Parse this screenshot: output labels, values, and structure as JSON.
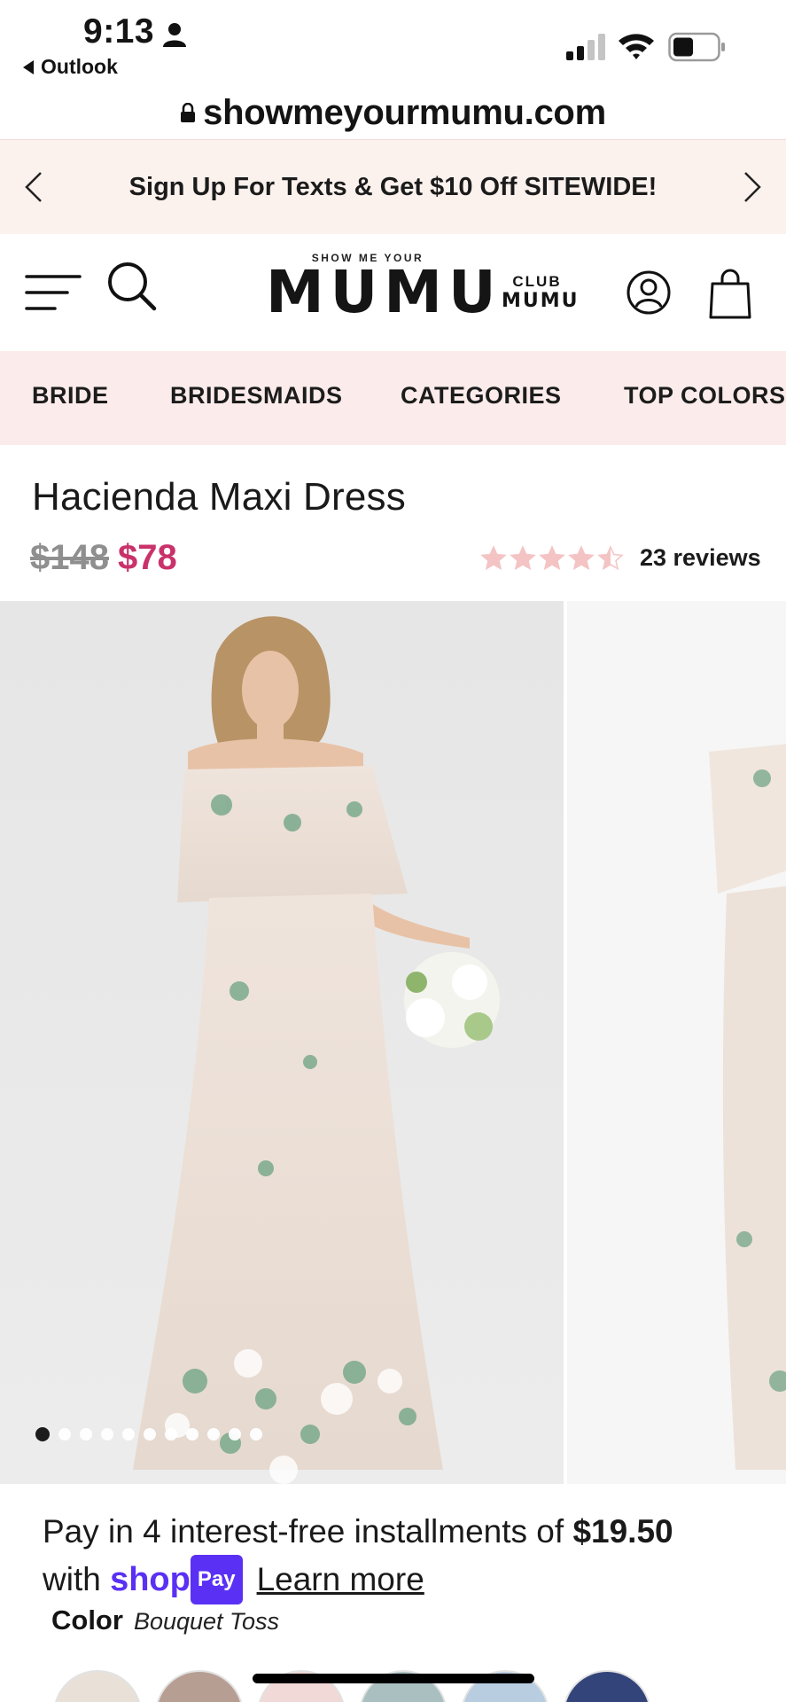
{
  "status_bar": {
    "time": "9:13",
    "back_app": "Outlook"
  },
  "url_bar": {
    "url": "showmeyourmumu.com"
  },
  "promo": {
    "text": "Sign Up For Texts & Get $10 Off SITEWIDE!"
  },
  "header": {
    "logo_small": "SHOW ME YOUR",
    "logo_big": "MUMU",
    "club_top": "CLUB",
    "club_bottom": "MUMU"
  },
  "nav": {
    "items": [
      {
        "label": "BRIDE"
      },
      {
        "label": "BRIDESMAIDS"
      },
      {
        "label": "CATEGORIES"
      },
      {
        "label": "TOP COLORS"
      }
    ]
  },
  "product": {
    "title": "Hacienda Maxi Dress",
    "price_old": "$148",
    "price_new": "$78",
    "rating": 4.5,
    "reviews": "23 reviews",
    "gallery": {
      "total_images": 11,
      "active_index": 0
    }
  },
  "shoppay": {
    "text": "Pay in 4 interest-free installments of ",
    "amount": "$19.50",
    "with": "with ",
    "shop": "shop",
    "pay": "Pay",
    "learn_more": "Learn more"
  },
  "color": {
    "label": "Color",
    "value": "Bouquet Toss",
    "swatch_colors": [
      "#e9e1d8",
      "#b79e93",
      "#f0d9d6",
      "#a9bfc0",
      "#b9cde0",
      "#33447a"
    ]
  },
  "colors": {
    "promo_bg": "#fbf1ed",
    "nav_bg": "#fbeceb",
    "sale_price": "#c9326a",
    "star": "#f4c4c4",
    "shop_pay": "#5a31f4"
  }
}
